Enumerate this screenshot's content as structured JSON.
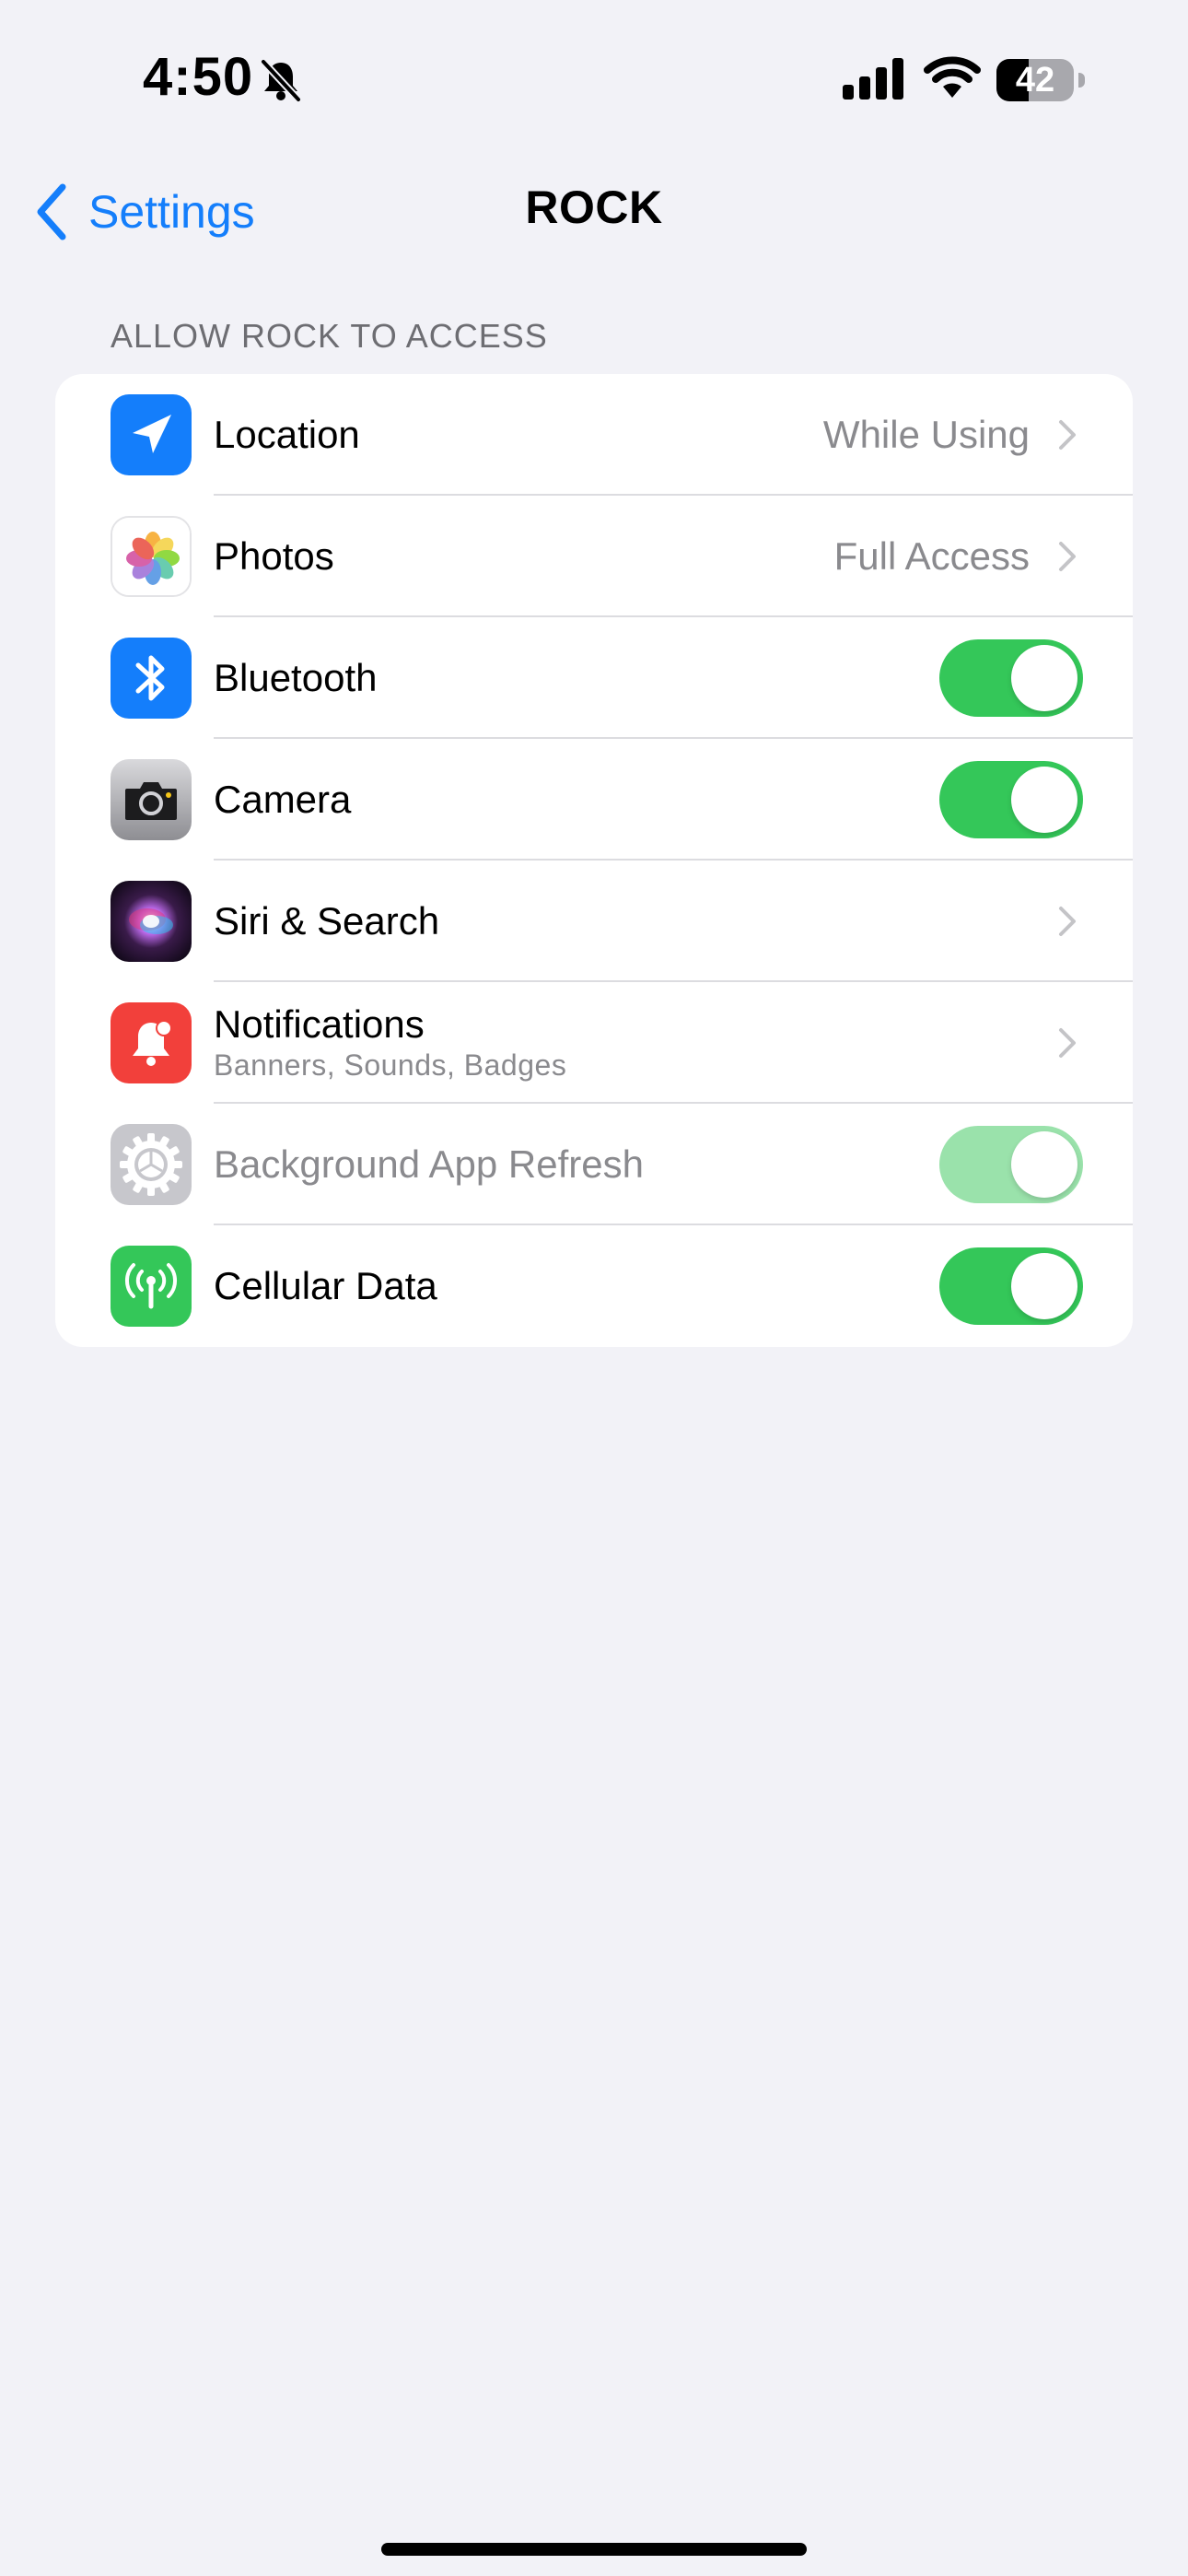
{
  "status_bar": {
    "time": "4:50",
    "battery_level": "42",
    "battery_fraction": 0.42,
    "icons": [
      "bell-slash-icon",
      "cellular-signal-icon",
      "wifi-icon",
      "battery-icon"
    ]
  },
  "nav": {
    "back_label": "Settings",
    "title": "ROCK"
  },
  "section": {
    "header": "ALLOW ROCK TO ACCESS",
    "rows": [
      {
        "label": "Location",
        "value": "While Using",
        "icon": "location-arrow-icon",
        "control": "chevron"
      },
      {
        "label": "Photos",
        "value": "Full Access",
        "icon": "photos-flower-icon",
        "control": "chevron"
      },
      {
        "label": "Bluetooth",
        "icon": "bluetooth-icon",
        "control": "toggle",
        "on": true
      },
      {
        "label": "Camera",
        "icon": "camera-icon",
        "control": "toggle",
        "on": true
      },
      {
        "label": "Siri & Search",
        "icon": "siri-icon",
        "control": "chevron"
      },
      {
        "label": "Notifications",
        "sublabel": "Banners, Sounds, Badges",
        "icon": "notification-bell-icon",
        "control": "chevron"
      },
      {
        "label": "Background App Refresh",
        "icon": "gear-icon",
        "control": "toggle",
        "on": true,
        "disabled": true
      },
      {
        "label": "Cellular Data",
        "icon": "antenna-icon",
        "control": "toggle",
        "on": true
      }
    ]
  },
  "colors": {
    "background": "#f2f2f7",
    "accent": "#147efb",
    "toggle_on": "#34c759",
    "toggle_on_disabled": "#9ae2ab",
    "location_icon_bg": "#147efb",
    "bluetooth_icon_bg": "#147efb",
    "notifications_icon_bg": "#f2403b",
    "cellular_icon_bg": "#34c759"
  }
}
